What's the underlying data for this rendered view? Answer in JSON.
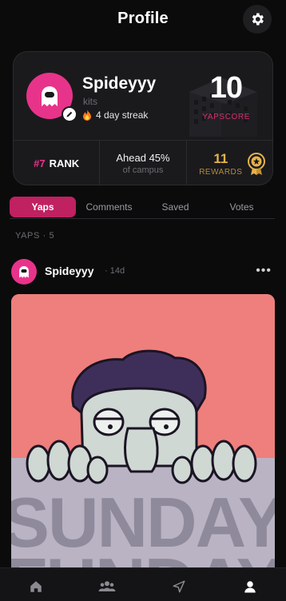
{
  "header": {
    "title": "Profile",
    "settings_icon": "gear-icon"
  },
  "profile": {
    "username": "Spideyyy",
    "subtitle": "kits",
    "streak_icon": "fire-icon",
    "streak": "4 day streak",
    "yapscore": "10",
    "yapscore_label": "YAPSCORE"
  },
  "stats": {
    "rank_number": "#7",
    "rank_label": "RANK",
    "ahead_main": "Ahead 45%",
    "ahead_sub": "of campus",
    "rewards_count": "11",
    "rewards_label": "REWARDS"
  },
  "tabs": [
    {
      "label": "Yaps",
      "active": true
    },
    {
      "label": "Comments",
      "active": false
    },
    {
      "label": "Saved",
      "active": false
    },
    {
      "label": "Votes",
      "active": false
    }
  ],
  "yaps_count": "YAPS · 5",
  "post": {
    "username": "Spideyyy",
    "time": "· 14d",
    "more_icon": "more-icon",
    "image_text_1": "SUNDAY",
    "image_text_2": "FUNDAY"
  },
  "bottom_nav": [
    {
      "icon": "home-icon"
    },
    {
      "icon": "people-icon"
    },
    {
      "icon": "send-icon"
    },
    {
      "icon": "profile-icon",
      "active": true
    }
  ],
  "colors": {
    "accent": "#e8338a",
    "tab_active": "#c02160",
    "gold": "#e6b24a",
    "background": "#0b0b0c"
  }
}
